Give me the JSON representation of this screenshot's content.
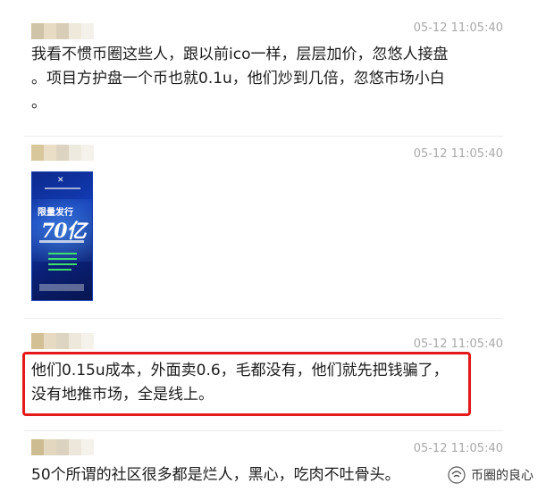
{
  "messages": [
    {
      "timestamp": "05-12 11:05:40",
      "text": "我看不惯币圈这些人，跟以前ico一样，层层加价，忽悠人接盘\n。项目方护盘一个币也就0.1u，他们炒到几倍，忽悠市场小白\n。"
    },
    {
      "timestamp": "05-12 11:05:40",
      "image": {
        "logo_text": "✕",
        "title": "限量发行",
        "big_text": "70亿"
      }
    },
    {
      "timestamp": "05-12 11:05:40",
      "text": "他们0.15u成本，外面卖0.6，毛都没有，他们就先把钱骗了，\n没有地推市场，全是线上。"
    },
    {
      "timestamp": "05-12 11:05:40",
      "text": "50个所谓的社区很多都是烂人，黑心，吃肉不吐骨头。"
    }
  ],
  "watermark": {
    "text": "币圈的良心",
    "icon": "wechat-channel-icon"
  },
  "colors": {
    "highlight_border": "#e3191b",
    "timestamp": "#a9a9a9",
    "poster_blue": "#123bb5"
  }
}
